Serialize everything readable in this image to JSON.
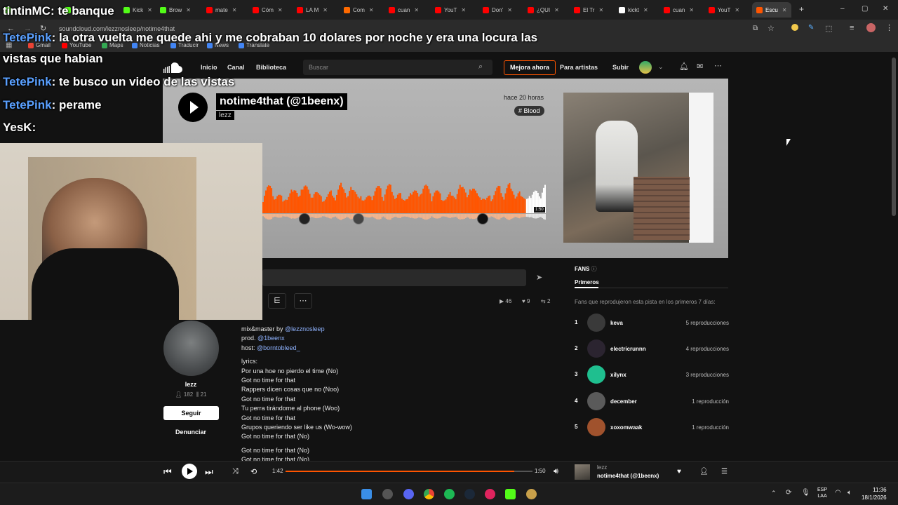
{
  "browser": {
    "tabs": [
      {
        "label": "",
        "color": "#53fc18"
      },
      {
        "label": "",
        "color": "#53fc18"
      },
      {
        "label": "Kick",
        "color": "#53fc18"
      },
      {
        "label": "Brow",
        "color": "#53fc18"
      },
      {
        "label": "mate",
        "color": "#ff0000"
      },
      {
        "label": "Cóm",
        "color": "#ff0000"
      },
      {
        "label": "LA M",
        "color": "#ff0000"
      },
      {
        "label": "Com",
        "color": "#ff6a00"
      },
      {
        "label": "cuan",
        "color": "#ff0000"
      },
      {
        "label": "YouT",
        "color": "#ff0000"
      },
      {
        "label": "Don'",
        "color": "#ff0000"
      },
      {
        "label": "¿QUI",
        "color": "#ff0000"
      },
      {
        "label": "El Tr",
        "color": "#ff0000"
      },
      {
        "label": "kickt",
        "color": "#ffffff"
      },
      {
        "label": "cuan",
        "color": "#ff0000"
      },
      {
        "label": "YouT",
        "color": "#ff0000"
      },
      {
        "label": "Escu",
        "color": "#ff5500"
      }
    ],
    "url": "soundcloud.com/lezznosleep/notime4that",
    "bookmarks": [
      "Gmail",
      "YouTube",
      "Maps",
      "Noticias",
      "Traducir",
      "News",
      "Translate"
    ]
  },
  "chat": [
    {
      "user": "tintinMC",
      "text": "te banque",
      "usercolor": "#ffffff"
    },
    {
      "user": "TetePink",
      "text": "la otra vuelta me quede ahi y me cobraban 10 dolares por noche y era una locura las",
      "usercolor": "#5aa0ff"
    },
    {
      "user": "",
      "text": "vistas que habian",
      "usercolor": "#5aa0ff"
    },
    {
      "user": "TetePink",
      "text": "te busco un video de las vistas",
      "usercolor": "#5aa0ff"
    },
    {
      "user": "TetePink",
      "text": "perame",
      "usercolor": "#5aa0ff"
    },
    {
      "user": "YesK",
      "text": "",
      "usercolor": "#ffffff"
    }
  ],
  "soundcloud": {
    "nav": {
      "home": "Inicio",
      "feed": "Canal",
      "library": "Biblioteca",
      "search_placeholder": "Buscar",
      "upgrade": "Mejora ahora",
      "for_artists": "Para artistas",
      "upload": "Subir"
    },
    "track": {
      "title": "notime4that (@1beenx)",
      "artist": "lezz",
      "posted": "hace 20 horas",
      "tag": "# Blood",
      "duration_badge": "1:50",
      "plays": "46",
      "likes": "9",
      "reposts": "2"
    },
    "uploader": {
      "name": "lezz",
      "followers": "182",
      "tracks": "21",
      "follow": "Seguir",
      "report": "Denunciar"
    },
    "description": {
      "line1_prefix": "mix&master by ",
      "line1_link": "@lezznosleep",
      "line2_prefix": "prod. ",
      "line2_link": "@1beenx",
      "line3_prefix": "host: ",
      "line3_link": "@borntobleed_",
      "lyrics_label": "lyrics:",
      "lyrics": [
        "Por una hoe no pierdo el time (No)",
        "Got no time for that",
        "Rappers dicen cosas que no (Noo)",
        "Got no time for that",
        "Tu perra tirándome al phone (Woo)",
        "Got no time for that",
        "Grupos queriendo ser like us (Wo-wow)",
        "Got no time for that (No)"
      ],
      "lyrics2": [
        "Got no time for that (No)",
        "Got no time for that (No)"
      ]
    },
    "fans": {
      "title": "FANS",
      "tab": "Primeros",
      "subtitle": "Fans que reprodujeron esta pista en los primeros 7 días:",
      "list": [
        {
          "rank": "1",
          "name": "keva",
          "plays": "5 reproducciones",
          "color": "#3a3a3a"
        },
        {
          "rank": "2",
          "name": "electricrunnn",
          "plays": "4 reproducciones",
          "color": "#2b2430"
        },
        {
          "rank": "3",
          "name": "xilynx",
          "plays": "3 reproducciones",
          "color": "#1fbf8f"
        },
        {
          "rank": "4",
          "name": "december",
          "plays": "1 reproducción",
          "color": "#5a5a5a"
        },
        {
          "rank": "5",
          "name": "xoxomwaak",
          "plays": "1 reproducción",
          "color": "#a0522d"
        }
      ]
    },
    "player": {
      "elapsed": "1:42",
      "total": "1:50",
      "progress": 0.927,
      "artist": "lezz",
      "title": "notime4that (@1beenx)"
    }
  },
  "taskbar": {
    "lang_line1": "ESP",
    "lang_line2": "LAA",
    "time": "11:36",
    "date": "18/1/2026"
  },
  "colors": {
    "accent": "#ff5500",
    "link": "#8fb3ff"
  }
}
